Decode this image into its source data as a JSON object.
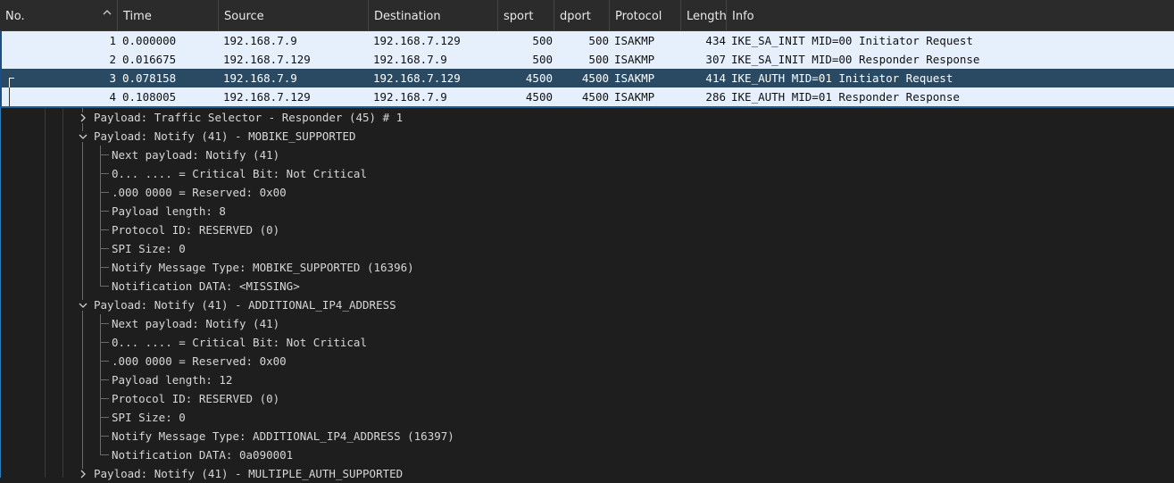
{
  "columns": [
    "No.",
    "Time",
    "Source",
    "Destination",
    "sport",
    "dport",
    "Protocol",
    "Length",
    "Info"
  ],
  "packets": [
    {
      "no": "1",
      "time": "0.000000",
      "src": "192.168.7.9",
      "dst": "192.168.7.129",
      "sport": "500",
      "dport": "500",
      "proto": "ISAKMP",
      "len": "434",
      "info": "IKE_SA_INIT MID=00 Initiator Request"
    },
    {
      "no": "2",
      "time": "0.016675",
      "src": "192.168.7.129",
      "dst": "192.168.7.9",
      "sport": "500",
      "dport": "500",
      "proto": "ISAKMP",
      "len": "307",
      "info": "IKE_SA_INIT MID=00 Responder Response"
    },
    {
      "no": "3",
      "time": "0.078158",
      "src": "192.168.7.9",
      "dst": "192.168.7.129",
      "sport": "4500",
      "dport": "4500",
      "proto": "ISAKMP",
      "len": "414",
      "info": "IKE_AUTH MID=01 Initiator Request"
    },
    {
      "no": "4",
      "time": "0.108005",
      "src": "192.168.7.129",
      "dst": "192.168.7.9",
      "sport": "4500",
      "dport": "4500",
      "proto": "ISAKMP",
      "len": "286",
      "info": "IKE_AUTH MID=01 Responder Response"
    }
  ],
  "selected_packet": "3",
  "details": [
    {
      "text": "Payload: Traffic Selector - Responder (45) # 1",
      "expanded": false
    },
    {
      "text": "Payload: Notify (41) - MOBIKE_SUPPORTED",
      "expanded": true,
      "children": [
        "Next payload: Notify (41)",
        "0... .... = Critical Bit: Not Critical",
        ".000 0000 = Reserved: 0x00",
        "Payload length: 8",
        "Protocol ID: RESERVED (0)",
        "SPI Size: 0",
        "Notify Message Type: MOBIKE_SUPPORTED (16396)",
        "Notification DATA: <MISSING>"
      ]
    },
    {
      "text": "Payload: Notify (41) - ADDITIONAL_IP4_ADDRESS",
      "expanded": true,
      "children": [
        "Next payload: Notify (41)",
        "0... .... = Critical Bit: Not Critical",
        ".000 0000 = Reserved: 0x00",
        "Payload length: 12",
        "Protocol ID: RESERVED (0)",
        "SPI Size: 0",
        "Notify Message Type: ADDITIONAL_IP4_ADDRESS (16397)",
        "Notification DATA: 0a090001"
      ]
    },
    {
      "text": "Payload: Notify (41) - MULTIPLE_AUTH_SUPPORTED",
      "expanded": false
    }
  ],
  "colors": {
    "header_bg": "#2b2b2b",
    "row_bg": "#e6f0fc",
    "selected_bg": "#2a4a63",
    "tree_bg": "#1e1e1e",
    "accent": "#2c7bbd"
  },
  "icons": {
    "sort": "chevron-up-icon",
    "collapsed": "chevron-right-icon",
    "expanded": "chevron-down-icon"
  }
}
